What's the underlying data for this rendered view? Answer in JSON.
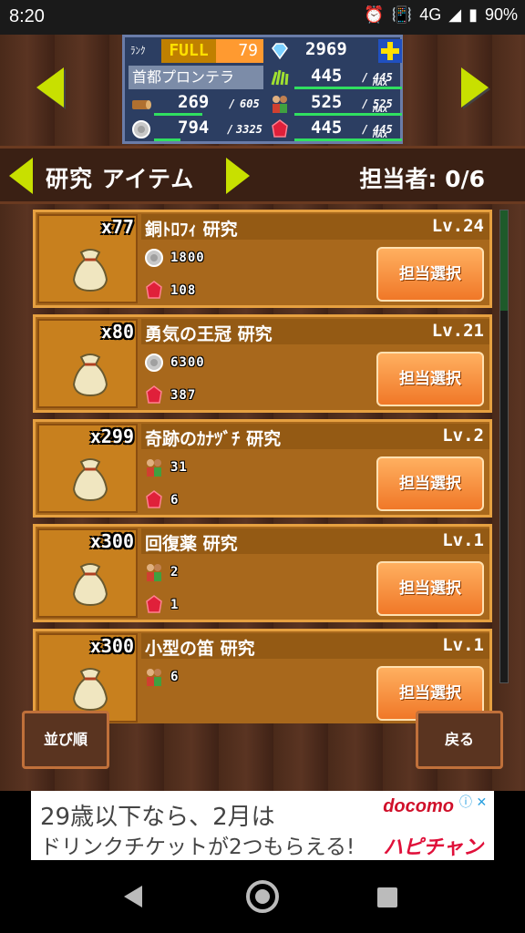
{
  "status_bar": {
    "time": "8:20",
    "network": "4G",
    "battery": "90%"
  },
  "panel": {
    "rank_label": "ﾗﾝｸ",
    "rank_status": "FULL",
    "rank_value": "79",
    "diamonds": "2969",
    "city_name": "首都プロンテラ",
    "grass_current": "445",
    "grass_max": "445",
    "wood_current": "269",
    "wood_max": "605",
    "workers_current": "525",
    "workers_max": "525",
    "silver_current": "794",
    "silver_max": "3325",
    "ruby_current": "445",
    "ruby_max": "445",
    "max_label": "MAX"
  },
  "header": {
    "title": "研究 アイテム",
    "staff": "担当者: 0/6"
  },
  "items": [
    {
      "count": "x77",
      "name": "銅ﾄﾛﾌｨ 研究",
      "level": "Lv.24",
      "req1_icon": "silver-coin-icon",
      "req1": "1800",
      "req2": "108",
      "button": "担当選択"
    },
    {
      "count": "x80",
      "name": "勇気の王冠 研究",
      "level": "Lv.21",
      "req1_icon": "silver-coin-icon",
      "req1": "6300",
      "req2": "387",
      "button": "担当選択"
    },
    {
      "count": "x299",
      "name": "奇跡のｶﾅﾂﾞﾁ 研究",
      "level": "Lv.2",
      "req1_icon": "workers-icon",
      "req1": "31",
      "req2": "6",
      "button": "担当選択"
    },
    {
      "count": "x300",
      "name": "回復薬 研究",
      "level": "Lv.1",
      "req1_icon": "workers-icon",
      "req1": "2",
      "req2": "1",
      "button": "担当選択"
    },
    {
      "count": "x300",
      "name": "小型の笛 研究",
      "level": "Lv.1",
      "req1_icon": "workers-icon",
      "req1": "6",
      "req2": "",
      "button": "担当選択"
    }
  ],
  "footer": {
    "sort_label": "並び順",
    "back_label": "戻る"
  },
  "ad": {
    "line1": "29歳以下なら、2月は",
    "line2": "ドリンクチケットが2つもらえる!",
    "brand": "docomo",
    "product": "ハピチャン"
  },
  "colors": {
    "accent_arrow": "#c8e000",
    "button_orange": "#f07828",
    "card_bg": "#a8681c"
  }
}
